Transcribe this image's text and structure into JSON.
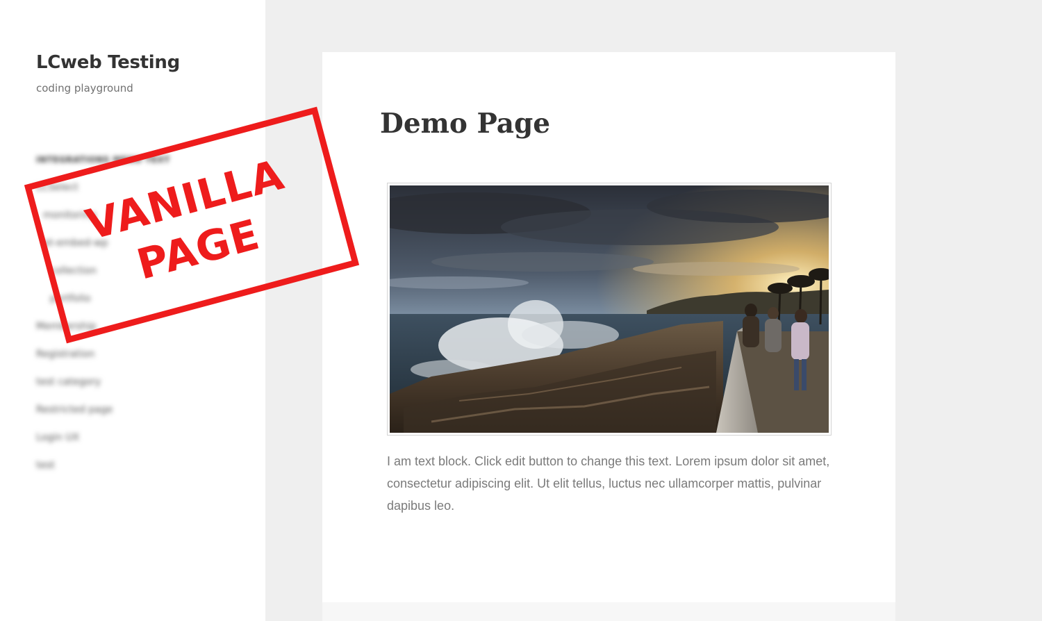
{
  "site": {
    "title": "LCweb Testing",
    "description": "coding playground"
  },
  "menu": [
    {
      "label": "INTEGRATIONS MENU TEXT"
    },
    {
      "label": "LCSelect"
    },
    {
      "label": "monitoring"
    },
    {
      "label": "pt-embed-wp"
    },
    {
      "label": "collection"
    },
    {
      "label": "portfolio"
    },
    {
      "label": "Membership"
    },
    {
      "label": "Registration"
    },
    {
      "label": "test category"
    },
    {
      "label": "Restricted page"
    },
    {
      "label": "Login UX"
    },
    {
      "label": "test"
    }
  ],
  "stamp": {
    "line1": "VANILLA",
    "line2": "PAGE",
    "color": "#ee1c1c"
  },
  "page": {
    "title": "Demo Page",
    "text": "I am text block. Click edit button to change this text. Lorem ipsum dolor sit amet, consectetur adipiscing elit. Ut elit tellus, luctus nec ullamcorper mattis, pulvinar dapibus leo."
  },
  "image": {
    "subject": "sunset-seaside-photo"
  }
}
